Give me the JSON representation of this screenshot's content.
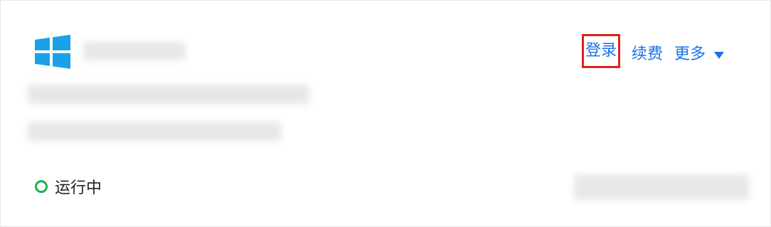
{
  "instance": {
    "os_icon": "windows-logo-icon",
    "brand_color": "#1aa1e8"
  },
  "actions": {
    "login_label": "登录",
    "renew_label": "续费",
    "more_label": "更多",
    "more_icon": "caret-down-icon",
    "accent_color": "#1a73e8",
    "highlight_color": "#e0201b"
  },
  "status": {
    "label": "运行中",
    "color": "#18b24b"
  }
}
